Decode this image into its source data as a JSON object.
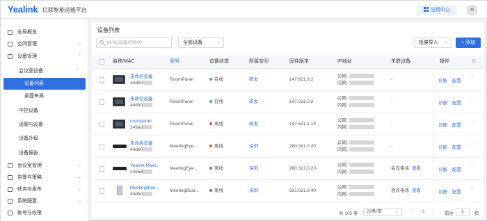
{
  "header": {
    "logo": "Yealink",
    "subtitle": "亿联智能运维平台",
    "workspace_button": "应用中心"
  },
  "sidebar": {
    "items": [
      {
        "label": "全局概览",
        "arrow": ""
      },
      {
        "label": "空间管理",
        "arrow": "⌄"
      },
      {
        "label": "设备管理",
        "arrow": "⌃"
      }
    ],
    "sub_group": {
      "label": "会议室设备",
      "arrow": "⌃"
    },
    "sub_items": [
      "设备列表",
      "桌面布局"
    ],
    "sub_items2": [
      "中控设备",
      "话筒与设备",
      "设备升级",
      "设备报告"
    ],
    "items_bottom": [
      {
        "label": "会议室管理",
        "arrow": "⌄"
      },
      {
        "label": "告警与策略",
        "arrow": "⌄"
      },
      {
        "label": "任务与发布",
        "arrow": "⌄"
      },
      {
        "label": "系统配置",
        "arrow": "⌄"
      },
      {
        "label": "帐号与权限",
        "arrow": ""
      }
    ]
  },
  "main": {
    "title": "设备列表",
    "search_placeholder": "MAC/设备名称/IP",
    "filter_all": "全部设备",
    "import_label": "批量导入",
    "add_label": "+ 添加",
    "columns": [
      "名称/MAC",
      "型号",
      "设备状态",
      "所属空间",
      "固件版本",
      "IP地址",
      "关联设备",
      "操作"
    ],
    "rows": [
      {
        "name": "未命名设备",
        "mac": "44db0",
        "model": "RoomPanel",
        "status": "在线",
        "status_color": "#3cb371",
        "space": "研发",
        "fw": "147.621.0.2",
        "ip_pub": "公网:",
        "ip_lan": "内网:",
        "linked": "-",
        "thumb": "tv",
        "actions": [
          "诊断",
          "配置"
        ]
      },
      {
        "name": "未命名设备",
        "mac": "44db0",
        "model": "RoomPanel",
        "status": "在线",
        "status_color": "#3cb371",
        "space": "研发",
        "fw": "147.621.0.2",
        "ip_pub": "公网:",
        "ip_lan": "内网:",
        "linked": "-",
        "thumb": "tv",
        "actions": [
          "诊断",
          "配置"
        ]
      },
      {
        "name": "roompanel",
        "mac": "249ad",
        "model": "RoomPanel",
        "status": "离线",
        "status_color": "#e74c3c",
        "space": "研发",
        "fw": "147.621.1.10",
        "ip_pub": "公网:",
        "ip_lan": "内网:",
        "linked": "-",
        "thumb": "tv",
        "actions": [
          "诊断",
          "配置"
        ]
      },
      {
        "name": "未命名设备",
        "mac": "44db0",
        "model": "MeetingEye...",
        "status": "离线",
        "status_color": "#e74c3c",
        "space": "深圳",
        "fw": "280.321.0.20",
        "ip_pub": "公网:",
        "ip_lan": "内网:",
        "linked": "-",
        "thumb": "bar",
        "actions": [
          "诊断",
          "配置"
        ]
      },
      {
        "name": "Yealink Meet...",
        "mac": "249ad",
        "model": "MeetingEye...",
        "status": "离线",
        "status_color": "#e74c3c",
        "space": "深圳",
        "fw": "280.321.0.20",
        "ip_pub": "公网:",
        "ip_lan": "内网:",
        "linked": "会议电话",
        "linked2": "查看",
        "thumb": "bar",
        "actions": [
          "诊断",
          "配置"
        ]
      },
      {
        "name": "MeetingBoar...",
        "mac": "44db0",
        "model": "MeetingBoar...",
        "status": "离线",
        "status_color": "#e74c3c",
        "space": "深圳",
        "fw": "331.621.0.40",
        "ip_pub": "公网:",
        "ip_lan": "内网:",
        "linked": "会议电话",
        "linked2": "查看",
        "thumb": "pod",
        "actions": [
          "诊断",
          "配置"
        ]
      }
    ],
    "pager": {
      "total": "共 105 条",
      "page_size": "20条/页",
      "prev": "‹",
      "current": "1",
      "next": "›",
      "goto": "前往",
      "goto_val": "1",
      "page_suffix": "页"
    }
  },
  "colors": {
    "accent": "#2f6fe0",
    "online": "#3cb371",
    "offline": "#e74c3c"
  }
}
